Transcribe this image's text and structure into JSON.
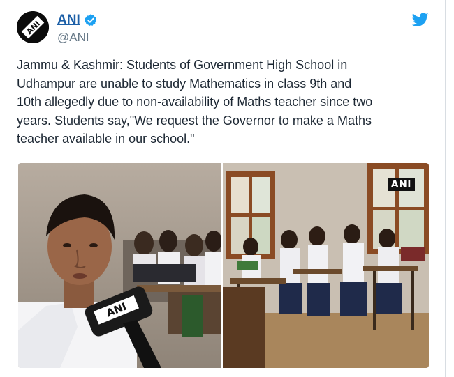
{
  "tweet": {
    "author_name": "ANI",
    "author_handle": "@ANI",
    "verified": true,
    "avatar_text": "ANI",
    "text_lines": [
      "Jammu & Kashmir: Students of Government High School in",
      "Udhampur are unable to study Mathematics in class 9th and",
      "10th allegedly due to non-availability of Maths teacher since two",
      "years. Students say,\"We request the Governor to make a Maths",
      "teacher available in our school.\""
    ]
  },
  "media": {
    "left_photo": {
      "description_icon": "student-interview-photo",
      "mic_label": "ANI"
    },
    "right_photo": {
      "description_icon": "classroom-photo",
      "watermark": "ANI"
    }
  },
  "icons": {
    "bird": "twitter-bird-icon",
    "verified": "verified-badge-icon"
  },
  "colors": {
    "link": "#1c5fa7",
    "twitter_blue": "#1da1f2",
    "handle": "#657786",
    "text": "#1c2733"
  }
}
